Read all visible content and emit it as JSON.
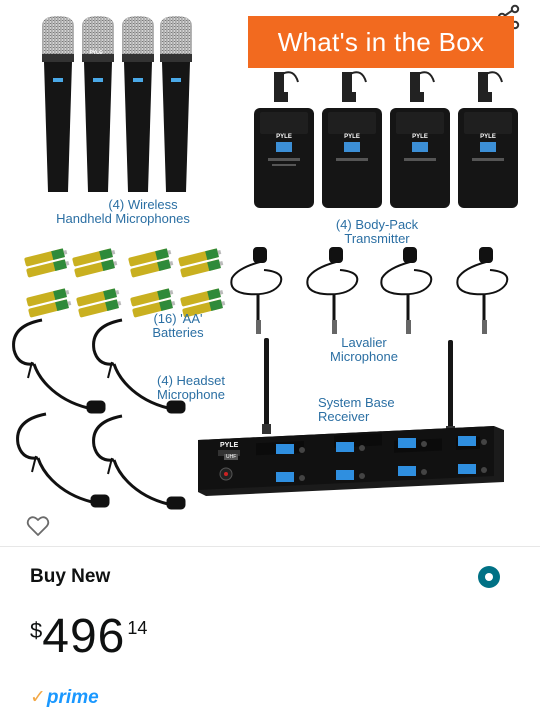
{
  "image": {
    "banner": "What's in the Box",
    "brand": "PYLE",
    "labels": {
      "handheld": [
        "(4) Wireless",
        "Handheld Microphones"
      ],
      "bodypack": [
        "(4) Body-Pack",
        "Transmitter"
      ],
      "batteries": [
        "(16) 'AA'",
        "Batteries"
      ],
      "lavalier": [
        "Lavalier",
        "Microphone"
      ],
      "headset": [
        "(4) Headset",
        "Microphone"
      ],
      "receiver": [
        "System Base",
        "Receiver"
      ]
    },
    "receiver_badge": "UHF",
    "icons": {
      "share": "share-icon",
      "heart": "heart-icon"
    }
  },
  "purchase": {
    "title": "Buy New",
    "price_symbol": "$",
    "price_whole": "496",
    "price_fraction": "14",
    "prime_label": "prime"
  },
  "colors": {
    "banner": "#f26a1f",
    "label": "#2b6fa3",
    "prime": "#1a98ff",
    "radio": "#007185"
  }
}
